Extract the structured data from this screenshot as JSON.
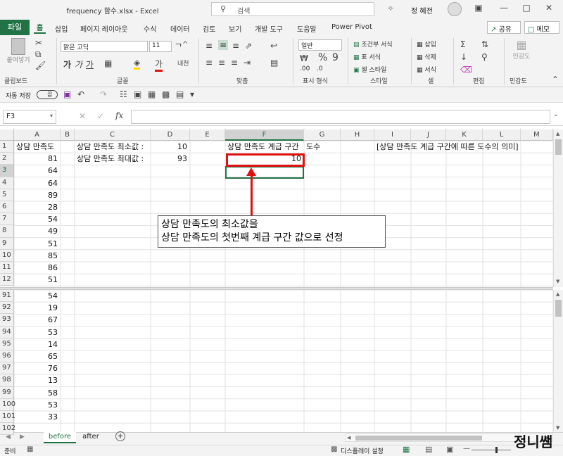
{
  "window": {
    "title": "frequency 함수.xlsx  -  Excel",
    "search_placeholder": "검색",
    "user": "정 혜전"
  },
  "tabs": [
    "파일",
    "홈",
    "삽입",
    "페이지 레이아웃",
    "수식",
    "데이터",
    "검토",
    "보기",
    "개발 도구",
    "도움말",
    "Power Pivot"
  ],
  "share_label": "공유",
  "memo_label": "메모",
  "ribbon": {
    "paste_label": "붙여넣기",
    "font_name": "맑은 고딕",
    "font_size": "11",
    "number_format": "일반",
    "conditional_format": "조건부 서식",
    "table_format": "표 서식",
    "cell_style": "셀 스타일",
    "insert": "삽입",
    "delete": "삭제",
    "format": "서식",
    "sensitivity": "민감도",
    "groups": [
      "클립보드",
      "글꼴",
      "맞춤",
      "표시 형식",
      "스타일",
      "셀",
      "편집",
      "민감도"
    ]
  },
  "qat": {
    "autosave_label": "자동 저장",
    "autosave_state": "끔"
  },
  "formula_bar": {
    "name_box": "F3",
    "fx": "fx",
    "formula": ""
  },
  "columns": [
    "A",
    "B",
    "C",
    "D",
    "E",
    "F",
    "G",
    "H",
    "I",
    "J",
    "K",
    "L",
    "M"
  ],
  "top_rows": [
    {
      "n": "1",
      "a": "상담 만족도",
      "c": "상담 만족도 최소값 :",
      "d": "10",
      "f": "상담 만족도 계급 구간",
      "g": "도수",
      "i": "[상담 만족도 계급 구간에 따른 도수의 의미]"
    },
    {
      "n": "2",
      "a": "81",
      "c": "상담 만족도 최대값 :",
      "d": "93",
      "f": "10"
    },
    {
      "n": "3",
      "a": "64"
    },
    {
      "n": "4",
      "a": "64"
    },
    {
      "n": "5",
      "a": "89"
    },
    {
      "n": "6",
      "a": "28"
    },
    {
      "n": "7",
      "a": "54"
    },
    {
      "n": "8",
      "a": "49"
    },
    {
      "n": "9",
      "a": "51"
    },
    {
      "n": "10",
      "a": "85"
    },
    {
      "n": "11",
      "a": "86"
    },
    {
      "n": "12",
      "a": "51"
    }
  ],
  "bottom_rows": [
    {
      "n": "91",
      "a": "54"
    },
    {
      "n": "92",
      "a": "19"
    },
    {
      "n": "93",
      "a": "67"
    },
    {
      "n": "94",
      "a": "53"
    },
    {
      "n": "95",
      "a": "14"
    },
    {
      "n": "96",
      "a": "65"
    },
    {
      "n": "97",
      "a": "76"
    },
    {
      "n": "98",
      "a": "13"
    },
    {
      "n": "99",
      "a": "58"
    },
    {
      "n": "100",
      "a": "53"
    },
    {
      "n": "101",
      "a": "33"
    },
    {
      "n": "102",
      "a": ""
    }
  ],
  "callout": {
    "line1": "상담 만족도의 최소값을",
    "line2": "상담 만족도의 첫번째 계급 구간 값으로 선정"
  },
  "sheets": [
    "before",
    "after"
  ],
  "status": {
    "ready": "준비",
    "display_settings": "디스플레이 설정"
  },
  "watermark": "정니쌤",
  "colors": {
    "excel_green": "#217346",
    "highlight_red": "#e01010"
  }
}
